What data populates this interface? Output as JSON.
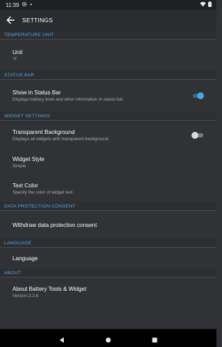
{
  "status_bar": {
    "time": "11:39",
    "settings_icon": "gear-icon",
    "wifi_icon": "wifi-icon",
    "battery_icon": "battery-icon",
    "battery_percent": "100",
    "dot": "•"
  },
  "app_bar": {
    "back_icon": "arrow-back-icon",
    "title": "SETTINGS"
  },
  "sections": [
    {
      "header": "TEMPERATURE UNIT",
      "items": [
        {
          "title": "Unit",
          "subtitle": "°F"
        }
      ]
    },
    {
      "header": "STATUS BAR",
      "items": [
        {
          "title": "Show in Status Bar",
          "subtitle": "Displays battery level and other information in status bar.",
          "toggle": true
        }
      ]
    },
    {
      "header": "WIDGET SETTINGS",
      "items": [
        {
          "title": "Transparent Background",
          "subtitle": "Displays all widgets with transparent background.",
          "toggle": false
        },
        {
          "title": "Widget Style",
          "subtitle": "Simple"
        },
        {
          "title": "Text Color",
          "subtitle": "Specify the color of widget text."
        }
      ]
    },
    {
      "header": "DATA PROTECTION CONSENT",
      "items": [
        {
          "title": "Withdraw data protection consent"
        }
      ]
    },
    {
      "header": "LANGUAGE",
      "items": [
        {
          "title": "Language"
        }
      ]
    },
    {
      "header": "ABOUT",
      "items": [
        {
          "title": "About Battery Tools & Widget",
          "subtitle": "Version:2.3.6"
        }
      ]
    }
  ],
  "nav_bar": {
    "back_icon": "nav-back-icon",
    "home_icon": "nav-home-icon",
    "recents_icon": "nav-recents-icon"
  },
  "colors": {
    "background": "#303236",
    "section_header_text": "#5ba7dc",
    "toggle_on": "#42a9e3",
    "toggle_off": "#d9d9d9"
  }
}
